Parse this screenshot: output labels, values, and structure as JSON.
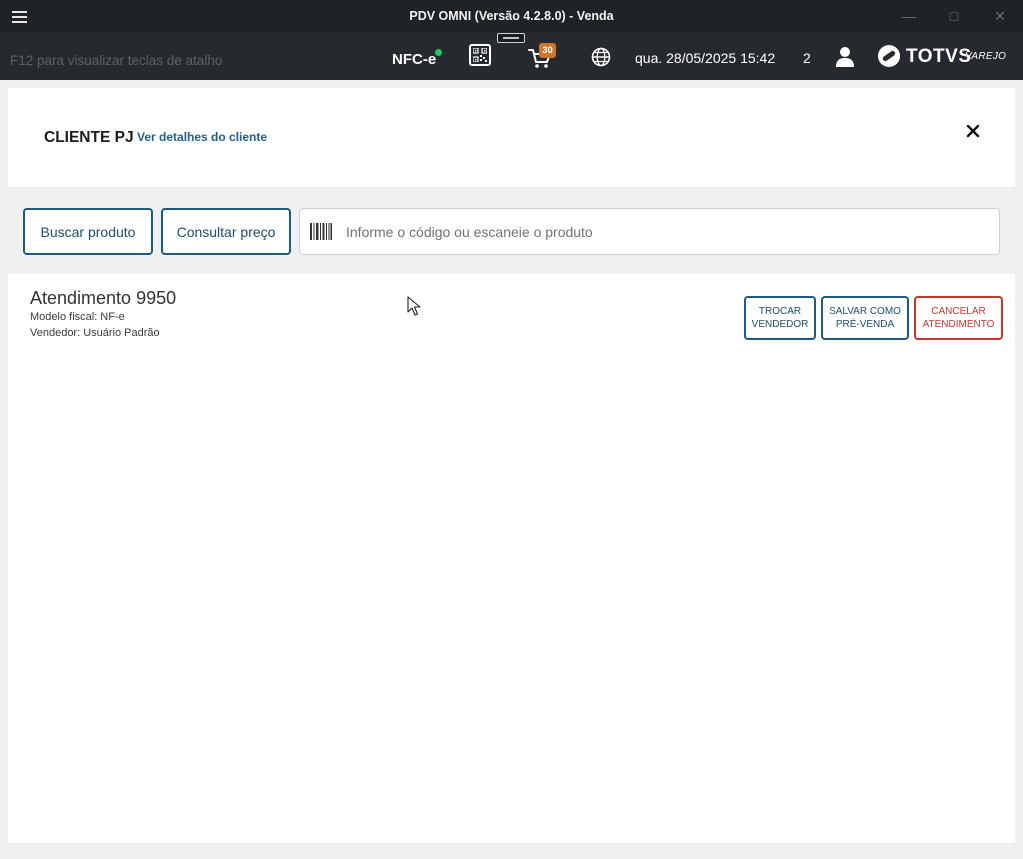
{
  "window": {
    "title": "PDV OMNI (Versão 4.2.8.0) - Venda",
    "minimize_icon": "minimize-icon",
    "maximize_icon": "maximize-icon",
    "close_icon": "close-icon"
  },
  "topbar": {
    "shortcut_hint": "F12 para visualizar teclas de atalho",
    "fiscal_mode": "NFC-e",
    "fiscal_status_color": "#22c55e",
    "cart_badge": "30",
    "datetime": "qua. 28/05/2025 15:42",
    "user_count": "2",
    "logo_text": "TOTVS",
    "logo_sub": "VAREJO"
  },
  "client": {
    "title": "CLIENTE PJ",
    "details_link": "Ver detalhes do cliente"
  },
  "search": {
    "buscar_label": "Buscar produto",
    "consultar_label": "Consultar preço",
    "placeholder": "Informe o código ou escaneie o produto"
  },
  "atendimento": {
    "title": "Atendimento 9950",
    "modelo_fiscal": "Modelo fiscal: NF-e",
    "vendedor": "Vendedor: Usuário Padrão",
    "trocar_label": "TROCAR\nVENDEDOR",
    "salvar_label": "SALVAR COMO\nPRÉ-VENDA",
    "cancelar_label": "CANCELAR\nATENDIMENTO"
  },
  "colors": {
    "accent": "#1d5b82",
    "danger": "#c0392b",
    "topbar_bg": "#262a2e"
  }
}
